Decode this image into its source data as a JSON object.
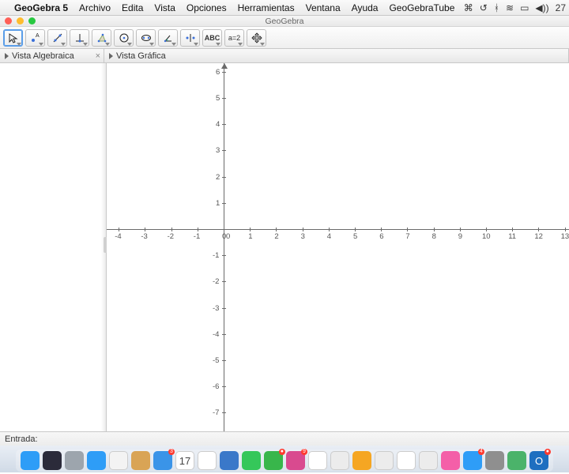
{
  "menubar": {
    "app_name": "GeoGebra 5",
    "items": [
      "Archivo",
      "Edita",
      "Vista",
      "Opciones",
      "Herramientas",
      "Ventana",
      "Ayuda",
      "GeoGebraTube"
    ],
    "right_status": {
      "clock": "27"
    }
  },
  "window": {
    "title": "GeoGebra"
  },
  "panels": {
    "algebra": {
      "title": "Vista Algebraica"
    },
    "graphics": {
      "title": "Vista Gráfica"
    }
  },
  "toolbar_tools": [
    {
      "name": "move-tool",
      "selected": true
    },
    {
      "name": "point-tool"
    },
    {
      "name": "line-tool"
    },
    {
      "name": "perpendicular-tool"
    },
    {
      "name": "polygon-tool"
    },
    {
      "name": "circle-tool"
    },
    {
      "name": "ellipse-tool"
    },
    {
      "name": "angle-tool"
    },
    {
      "name": "reflect-tool"
    },
    {
      "name": "text-tool",
      "label": "ABC"
    },
    {
      "name": "slider-tool",
      "label": "a=2"
    },
    {
      "name": "move-view-tool"
    }
  ],
  "chart_data": {
    "type": "scatter",
    "title": "",
    "xlabel": "",
    "ylabel": "",
    "xlim": [
      -4,
      13
    ],
    "ylim": [
      -7,
      6
    ],
    "x_ticks": [
      -4,
      -3,
      -2,
      -1,
      0,
      1,
      2,
      3,
      4,
      5,
      6,
      7,
      8,
      9,
      10,
      11,
      12,
      13
    ],
    "y_ticks": [
      -7,
      -6,
      -5,
      -4,
      -3,
      -2,
      -1,
      0,
      1,
      2,
      3,
      4,
      5,
      6
    ],
    "series": []
  },
  "input_bar": {
    "label": "Entrada:",
    "value": ""
  },
  "dock": {
    "items": [
      {
        "name": "finder",
        "color": "#2e9df7"
      },
      {
        "name": "siri",
        "color": "#2b2b3a"
      },
      {
        "name": "launchpad",
        "color": "#9da5ad"
      },
      {
        "name": "safari",
        "color": "#2e9df7"
      },
      {
        "name": "chrome",
        "color": "#f3f3f3"
      },
      {
        "name": "notes-app",
        "color": "#d9a455"
      },
      {
        "name": "mail",
        "color": "#3a94e8",
        "badge": "3"
      },
      {
        "name": "calendar",
        "color": "#ffffff",
        "text": "17",
        "text_color": "#d33"
      },
      {
        "name": "reminders",
        "color": "#ffffff"
      },
      {
        "name": "preview",
        "color": "#3a78c9"
      },
      {
        "name": "messages",
        "color": "#35c75a"
      },
      {
        "name": "wechat",
        "color": "#38b64b",
        "badge": "●"
      },
      {
        "name": "slack",
        "color": "#d94a8f",
        "badge": "9"
      },
      {
        "name": "photos",
        "color": "#ffffff"
      },
      {
        "name": "facetime",
        "color": "#ececec"
      },
      {
        "name": "ibooks",
        "color": "#f5a623"
      },
      {
        "name": "maps",
        "color": "#ececec"
      },
      {
        "name": "geogebra",
        "color": "#ffffff"
      },
      {
        "name": "textedit",
        "color": "#ececec"
      },
      {
        "name": "itunes",
        "color": "#f45fa8"
      },
      {
        "name": "appstore",
        "color": "#2e9df7",
        "badge": "4"
      },
      {
        "name": "settings",
        "color": "#8f8f8f"
      },
      {
        "name": "app-x",
        "color": "#4bb36a"
      },
      {
        "name": "outlook",
        "color": "#1e6fc0",
        "text": "O",
        "badge": "●"
      }
    ]
  }
}
